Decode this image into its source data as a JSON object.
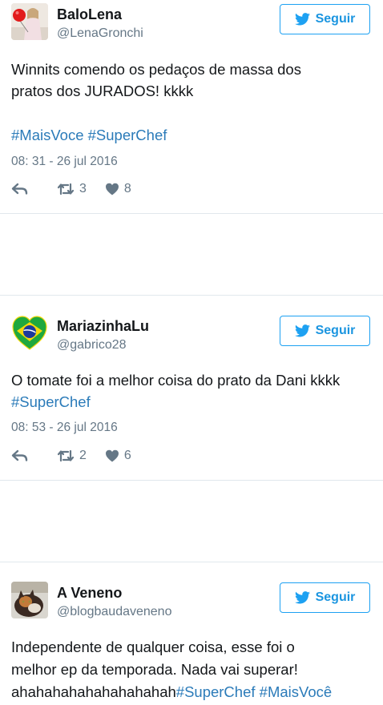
{
  "follow_label": "Seguir",
  "accent_color": "#1da1f2",
  "tweets": [
    {
      "name": "BaloLena",
      "handle": "@LenaGronchi",
      "lines": [
        [
          {
            "t": "Winnits comendo os pedaços de massa dos"
          }
        ],
        [
          {
            "t": "pratos dos JURADOS! kkkk"
          }
        ],
        [
          {
            "t": "#MaisVoce",
            "h": true
          },
          {
            "t": " "
          },
          {
            "t": "#SuperChef",
            "h": true
          }
        ]
      ],
      "timestamp": "08: 31 - 26 jul 2016",
      "retweets": "3",
      "likes": "8",
      "avatar": "girl-with-red-balloon"
    },
    {
      "name": "MariazinhaLu",
      "handle": "@gabrico28",
      "lines": [
        [
          {
            "t": "O tomate foi a melhor coisa do prato da Dani kkkk"
          }
        ],
        [
          {
            "t": "#SuperChef",
            "h": true
          }
        ]
      ],
      "timestamp": "08: 53 - 26 jul 2016",
      "retweets": "2",
      "likes": "6",
      "avatar": "brazil-flag-heart"
    },
    {
      "name": "A Veneno",
      "handle": "@blogbaudaveneno",
      "lines": [
        [
          {
            "t": "Independente de qualquer coisa, esse foi o"
          }
        ],
        [
          {
            "t": "melhor ep da temporada. Nada vai superar!"
          }
        ],
        [
          {
            "t": "ahahahahahahahahahah"
          },
          {
            "t": "#SuperChef",
            "h": true
          },
          {
            "t": " "
          },
          {
            "t": "#MaisVocê",
            "h": true
          }
        ]
      ],
      "avatar": "cat-photo"
    }
  ]
}
